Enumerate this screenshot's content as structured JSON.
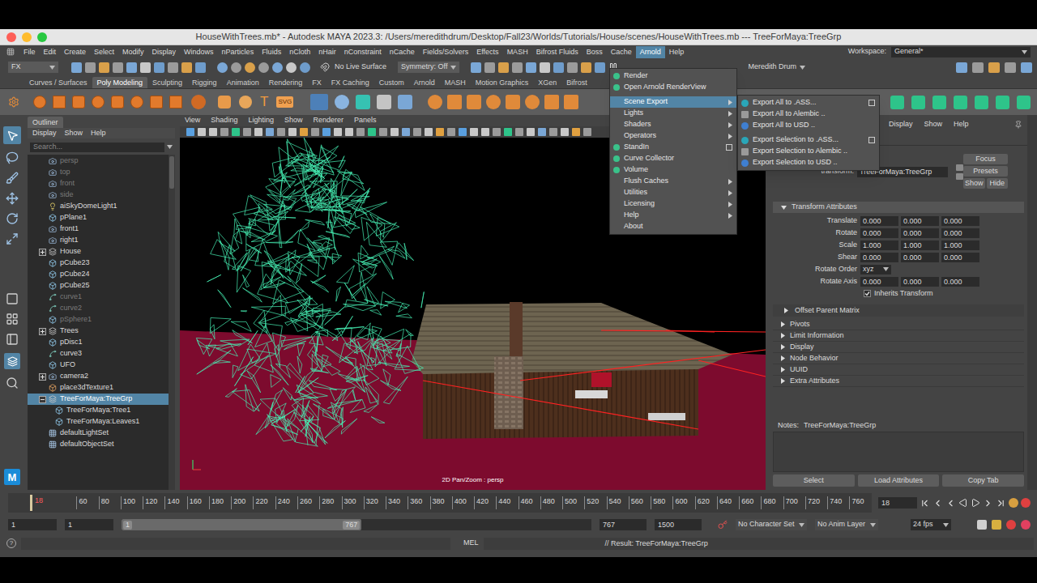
{
  "window": {
    "title": "HouseWithTrees.mb* - Autodesk MAYA 2023.3: /Users/meredithdrum/Desktop/Fall23/Worlds/Tutorials/House/scenes/HouseWithTrees.mb --- TreeForMaya:TreeGrp",
    "workspace_label": "Workspace:",
    "workspace": "General*",
    "logo": "M"
  },
  "menubar": [
    {
      "label": "File",
      "selected": false
    },
    {
      "label": "Edit",
      "selected": false
    },
    {
      "label": "Create",
      "selected": false
    },
    {
      "label": "Select",
      "selected": false
    },
    {
      "label": "Modify",
      "selected": false
    },
    {
      "label": "Display",
      "selected": false
    },
    {
      "label": "Windows",
      "selected": false
    },
    {
      "label": "nParticles",
      "selected": false
    },
    {
      "label": "Fluids",
      "selected": false
    },
    {
      "label": "nCloth",
      "selected": false
    },
    {
      "label": "nHair",
      "selected": false
    },
    {
      "label": "nConstraint",
      "selected": false
    },
    {
      "label": "nCache",
      "selected": false
    },
    {
      "label": "Fields/Solvers",
      "selected": false
    },
    {
      "label": "Effects",
      "selected": false
    },
    {
      "label": "MASH",
      "selected": false
    },
    {
      "label": "Bifrost Fluids",
      "selected": false
    },
    {
      "label": "Boss",
      "selected": false
    },
    {
      "label": "Cache",
      "selected": false
    },
    {
      "label": "Arnold",
      "selected": true
    },
    {
      "label": "Help",
      "selected": false
    }
  ],
  "status_line": {
    "mode": "FX",
    "live_surface": "No Live Surface",
    "symmetry": "Symmetry: Off",
    "user": "Meredith Drum"
  },
  "shelf": {
    "tabs": [
      {
        "label": "Curves / Surfaces",
        "selected": false
      },
      {
        "label": "Poly Modeling",
        "selected": true
      },
      {
        "label": "Sculpting",
        "selected": false
      },
      {
        "label": "Rigging",
        "selected": false
      },
      {
        "label": "Animation",
        "selected": false
      },
      {
        "label": "Rendering",
        "selected": false
      },
      {
        "label": "FX",
        "selected": false
      },
      {
        "label": "FX Caching",
        "selected": false
      },
      {
        "label": "Custom",
        "selected": false
      },
      {
        "label": "Arnold",
        "selected": false
      },
      {
        "label": "MASH",
        "selected": false
      },
      {
        "label": "Motion Graphics",
        "selected": false
      },
      {
        "label": "XGen",
        "selected": false
      },
      {
        "label": "Bifrost",
        "selected": false
      }
    ],
    "text_icons": [
      "T",
      "SVG"
    ]
  },
  "outliner": {
    "title": "Outliner",
    "menu": [
      "Display",
      "Show",
      "Help"
    ],
    "search_placeholder": "Search...",
    "items": [
      {
        "label": "persp",
        "kind": "camera",
        "depth": 0,
        "expandable": false,
        "expanded": false,
        "greyed": true,
        "selected": false
      },
      {
        "label": "top",
        "kind": "camera",
        "depth": 0,
        "expandable": false,
        "expanded": false,
        "greyed": true,
        "selected": false
      },
      {
        "label": "front",
        "kind": "camera",
        "depth": 0,
        "expandable": false,
        "expanded": false,
        "greyed": true,
        "selected": false
      },
      {
        "label": "side",
        "kind": "camera",
        "depth": 0,
        "expandable": false,
        "expanded": false,
        "greyed": true,
        "selected": false
      },
      {
        "label": "aiSkyDomeLight1",
        "kind": "light",
        "depth": 0,
        "expandable": false,
        "expanded": false,
        "greyed": false,
        "selected": false
      },
      {
        "label": "pPlane1",
        "kind": "mesh",
        "depth": 0,
        "expandable": false,
        "expanded": false,
        "greyed": false,
        "selected": false
      },
      {
        "label": "front1",
        "kind": "camera",
        "depth": 0,
        "expandable": false,
        "expanded": false,
        "greyed": false,
        "selected": false
      },
      {
        "label": "right1",
        "kind": "camera",
        "depth": 0,
        "expandable": false,
        "expanded": false,
        "greyed": false,
        "selected": false
      },
      {
        "label": "House",
        "kind": "group",
        "depth": 0,
        "expandable": true,
        "expanded": false,
        "greyed": false,
        "selected": false
      },
      {
        "label": "pCube23",
        "kind": "mesh",
        "depth": 0,
        "expandable": false,
        "expanded": false,
        "greyed": false,
        "selected": false
      },
      {
        "label": "pCube24",
        "kind": "mesh",
        "depth": 0,
        "expandable": false,
        "expanded": false,
        "greyed": false,
        "selected": false
      },
      {
        "label": "pCube25",
        "kind": "mesh",
        "depth": 0,
        "expandable": false,
        "expanded": false,
        "greyed": false,
        "selected": false
      },
      {
        "label": "curve1",
        "kind": "curve",
        "depth": 0,
        "expandable": false,
        "expanded": false,
        "greyed": true,
        "selected": false
      },
      {
        "label": "curve2",
        "kind": "curve",
        "depth": 0,
        "expandable": false,
        "expanded": false,
        "greyed": true,
        "selected": false
      },
      {
        "label": "pSphere1",
        "kind": "mesh",
        "depth": 0,
        "expandable": false,
        "expanded": false,
        "greyed": true,
        "selected": false
      },
      {
        "label": "Trees",
        "kind": "group",
        "depth": 0,
        "expandable": true,
        "expanded": false,
        "greyed": false,
        "selected": false
      },
      {
        "label": "pDisc1",
        "kind": "mesh",
        "depth": 0,
        "expandable": false,
        "expanded": false,
        "greyed": false,
        "selected": false
      },
      {
        "label": "curve3",
        "kind": "curve",
        "depth": 0,
        "expandable": false,
        "expanded": false,
        "greyed": false,
        "selected": false
      },
      {
        "label": "UFO",
        "kind": "mesh",
        "depth": 0,
        "expandable": false,
        "expanded": false,
        "greyed": false,
        "selected": false
      },
      {
        "label": "camera2",
        "kind": "camera",
        "depth": 0,
        "expandable": true,
        "expanded": false,
        "greyed": false,
        "selected": false
      },
      {
        "label": "place3dTexture1",
        "kind": "texture",
        "depth": 0,
        "expandable": false,
        "expanded": false,
        "greyed": false,
        "selected": false
      },
      {
        "label": "TreeForMaya:TreeGrp",
        "kind": "group",
        "depth": 0,
        "expandable": true,
        "expanded": true,
        "greyed": false,
        "selected": true
      },
      {
        "label": "TreeForMaya:Tree1",
        "kind": "mesh",
        "depth": 1,
        "expandable": false,
        "expanded": false,
        "greyed": false,
        "selected": false
      },
      {
        "label": "TreeForMaya:Leaves1",
        "kind": "mesh",
        "depth": 1,
        "expandable": false,
        "expanded": false,
        "greyed": false,
        "selected": false
      },
      {
        "label": "defaultLightSet",
        "kind": "set",
        "depth": 0,
        "expandable": false,
        "expanded": false,
        "greyed": false,
        "selected": false
      },
      {
        "label": "defaultObjectSet",
        "kind": "set",
        "depth": 0,
        "expandable": false,
        "expanded": false,
        "greyed": false,
        "selected": false
      }
    ]
  },
  "viewport": {
    "menu": [
      "View",
      "Shading",
      "Lighting",
      "Show",
      "Renderer",
      "Panels"
    ],
    "hud": "2D Pan/Zoom : persp"
  },
  "arnold_menu": {
    "items": [
      {
        "label": "Render",
        "has_icon": true,
        "submenu": false,
        "option_box": false,
        "separator_before": false,
        "selected": false
      },
      {
        "label": "Open Arnold RenderView",
        "has_icon": true,
        "submenu": false,
        "option_box": false,
        "separator_before": false,
        "selected": false
      },
      {
        "label": "Scene Export",
        "has_icon": false,
        "submenu": true,
        "option_box": false,
        "separator_before": true,
        "selected": true
      },
      {
        "label": "Lights",
        "has_icon": false,
        "submenu": true,
        "option_box": false,
        "separator_before": false,
        "selected": false
      },
      {
        "label": "Shaders",
        "has_icon": false,
        "submenu": true,
        "option_box": false,
        "separator_before": false,
        "selected": false
      },
      {
        "label": "Operators",
        "has_icon": false,
        "submenu": true,
        "option_box": false,
        "separator_before": false,
        "selected": false
      },
      {
        "label": "StandIn",
        "has_icon": true,
        "submenu": false,
        "option_box": true,
        "separator_before": false,
        "selected": false
      },
      {
        "label": "Curve Collector",
        "has_icon": true,
        "submenu": false,
        "option_box": false,
        "separator_before": false,
        "selected": false
      },
      {
        "label": "Volume",
        "has_icon": true,
        "submenu": false,
        "option_box": false,
        "separator_before": false,
        "selected": false
      },
      {
        "label": "Flush Caches",
        "has_icon": false,
        "submenu": true,
        "option_box": false,
        "separator_before": false,
        "selected": false
      },
      {
        "label": "Utilities",
        "has_icon": false,
        "submenu": true,
        "option_box": false,
        "separator_before": false,
        "selected": false
      },
      {
        "label": "Licensing",
        "has_icon": false,
        "submenu": true,
        "option_box": false,
        "separator_before": false,
        "selected": false
      },
      {
        "label": "Help",
        "has_icon": false,
        "submenu": true,
        "option_box": false,
        "separator_before": false,
        "selected": false
      },
      {
        "label": "About",
        "has_icon": false,
        "submenu": false,
        "option_box": false,
        "separator_before": false,
        "selected": false
      }
    ]
  },
  "scene_export_submenu": {
    "items": [
      {
        "label": "Export All to .ASS...",
        "kind": "ass",
        "option_box": true,
        "separator_before": false
      },
      {
        "label": "Export All to Alembic ..",
        "kind": "alembic",
        "option_box": false,
        "separator_before": false
      },
      {
        "label": "Export All to USD ..",
        "kind": "usd",
        "option_box": false,
        "separator_before": false
      },
      {
        "label": "Export Selection to .ASS...",
        "kind": "ass",
        "option_box": true,
        "separator_before": true
      },
      {
        "label": "Export Selection to Alembic ..",
        "kind": "alembic",
        "option_box": false,
        "separator_before": false
      },
      {
        "label": "Export Selection to USD ..",
        "kind": "usd",
        "option_box": false,
        "separator_before": false
      }
    ]
  },
  "attribute_editor": {
    "menu": [
      "Display",
      "Show",
      "Help"
    ],
    "node_type_label": "transform:",
    "node_name": "TreeForMaya:TreeGrp",
    "focus_button": "Focus",
    "presets_button": "Presets",
    "show_button": "Show",
    "hide_button": "Hide",
    "section": {
      "label": "Transform Attributes",
      "expanded": true
    },
    "rows": [
      {
        "label": "Translate",
        "kind": "vector",
        "values": [
          "0.000",
          "0.000",
          "0.000"
        ]
      },
      {
        "label": "Rotate",
        "kind": "vector",
        "values": [
          "0.000",
          "0.000",
          "0.000"
        ]
      },
      {
        "label": "Scale",
        "kind": "vector",
        "values": [
          "1.000",
          "1.000",
          "1.000"
        ]
      },
      {
        "label": "Shear",
        "kind": "vector",
        "values": [
          "0.000",
          "0.000",
          "0.000"
        ]
      },
      {
        "label": "Rotate Order",
        "kind": "dropdown",
        "values": [
          "xyz"
        ]
      },
      {
        "label": "Rotate Axis",
        "kind": "vector",
        "values": [
          "0.000",
          "0.000",
          "0.000"
        ]
      },
      {
        "label": "Inherits Transform",
        "kind": "checkbox",
        "values": [],
        "checked": true
      }
    ],
    "subsection": {
      "label": "Offset Parent Matrix",
      "expanded": false
    },
    "sections": [
      {
        "label": "Pivots",
        "expanded": false
      },
      {
        "label": "Limit Information",
        "expanded": false
      },
      {
        "label": "Display",
        "expanded": false
      },
      {
        "label": "Node Behavior",
        "expanded": false
      },
      {
        "label": "UUID",
        "expanded": false
      },
      {
        "label": "Extra Attributes",
        "expanded": false
      }
    ],
    "notes_label": "Notes:",
    "notes_node": "TreeForMaya:TreeGrp",
    "buttons": [
      "Select",
      "Load Attributes",
      "Copy Tab"
    ]
  },
  "time_slider": {
    "ticks": [
      "60",
      "80",
      "100",
      "120",
      "140",
      "160",
      "180",
      "200",
      "220",
      "240",
      "260",
      "280",
      "300",
      "320",
      "340",
      "360",
      "380",
      "400",
      "420",
      "440",
      "460",
      "480",
      "500",
      "520",
      "540",
      "560",
      "580",
      "600",
      "620",
      "640",
      "660",
      "680",
      "700",
      "720",
      "740",
      "760"
    ],
    "current_frame": "18",
    "level": 0.022,
    "frame_field": "18"
  },
  "range_slider": {
    "start": "1",
    "playback_start": "1",
    "slider_min": "1",
    "slider_max": "767",
    "playback_end": "767",
    "end": "1500",
    "character_set": "No Character Set",
    "anim_layer": "No Anim Layer",
    "fps": "24 fps"
  },
  "command_line": {
    "help_glyph": "?",
    "language": "MEL",
    "result": "// Result: TreeForMaya:TreeGrp"
  }
}
